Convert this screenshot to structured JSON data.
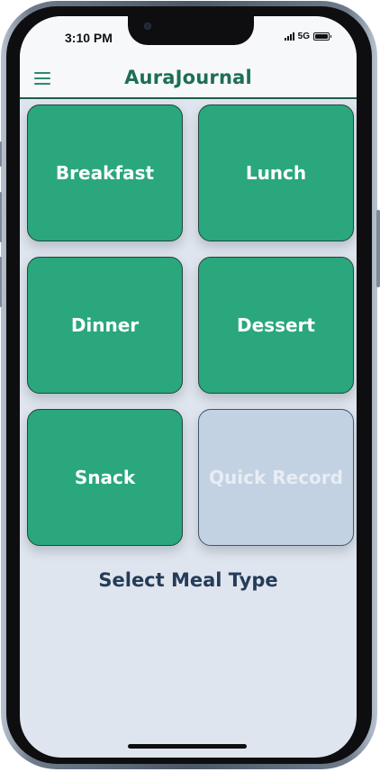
{
  "status_bar": {
    "time": "3:10 PM",
    "network": "5G"
  },
  "header": {
    "title": "AuraJournal",
    "menu_icon": "hamburger-menu-icon"
  },
  "meal_types": [
    {
      "label": "Breakfast",
      "enabled": true
    },
    {
      "label": "Lunch",
      "enabled": true
    },
    {
      "label": "Dinner",
      "enabled": true
    },
    {
      "label": "Dessert",
      "enabled": true
    },
    {
      "label": "Snack",
      "enabled": true
    },
    {
      "label": "Quick Record",
      "enabled": false
    }
  ],
  "footer": {
    "label": "Select Meal Type"
  },
  "colors": {
    "accent": "#2aa77c",
    "title": "#1d6e56",
    "disabled_tile": "#c3d2e2",
    "footer_text": "#243c58",
    "background": "#dfe5ee"
  }
}
